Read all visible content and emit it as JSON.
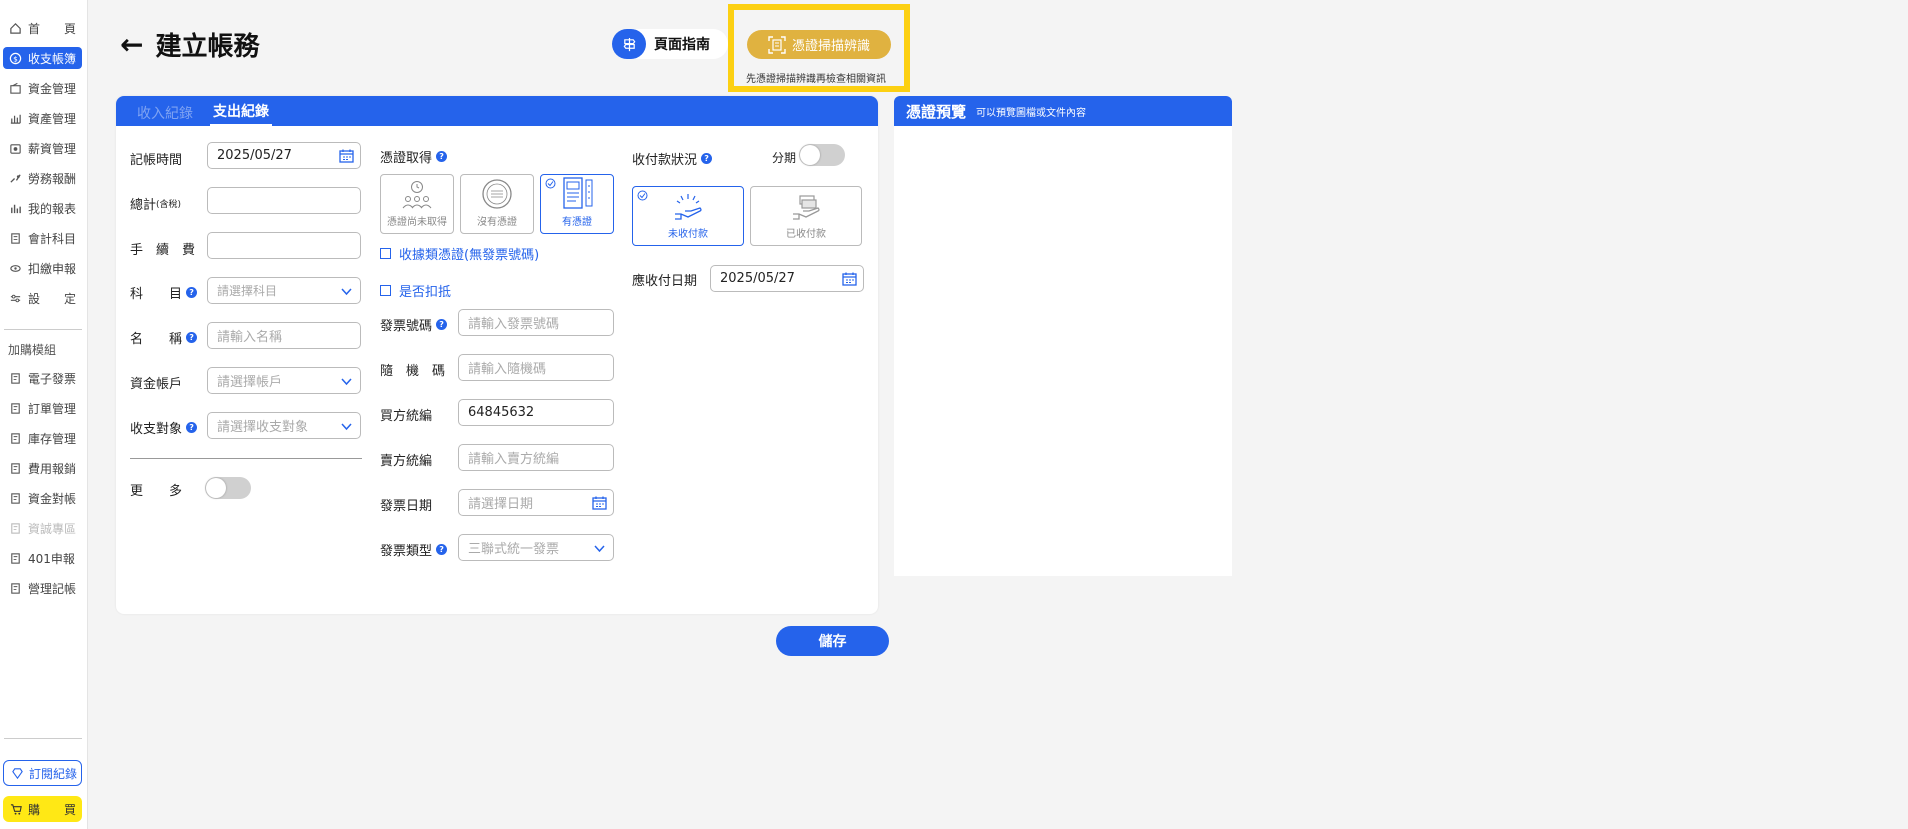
{
  "sidebar": {
    "items": [
      {
        "label": "首　　頁",
        "icon": "home-icon"
      },
      {
        "label": "收支帳簿",
        "icon": "dollar-circle-icon"
      },
      {
        "label": "資金管理",
        "icon": "wallet-icon"
      },
      {
        "label": "資產管理",
        "icon": "asset-chart-icon"
      },
      {
        "label": "薪資管理",
        "icon": "salary-icon"
      },
      {
        "label": "勞務報酬",
        "icon": "service-icon"
      },
      {
        "label": "我的報表",
        "icon": "report-chart-icon"
      },
      {
        "label": "會計科目",
        "icon": "account-book-icon"
      },
      {
        "label": "扣繳申報",
        "icon": "declare-icon"
      },
      {
        "label": "設　　定",
        "icon": "settings-sliders-icon"
      }
    ],
    "addon_section": "加購模組",
    "addon_items": [
      {
        "label": "電子發票",
        "icon": "document-icon"
      },
      {
        "label": "訂單管理",
        "icon": "document-icon"
      },
      {
        "label": "庫存管理",
        "icon": "document-icon"
      },
      {
        "label": "費用報銷",
        "icon": "document-icon"
      },
      {
        "label": "資金對帳",
        "icon": "document-icon"
      },
      {
        "label": "資誠專區",
        "icon": "document-icon"
      },
      {
        "label": "401申報",
        "icon": "document-icon"
      },
      {
        "label": "營理記帳",
        "icon": "document-icon"
      }
    ],
    "subscription": "訂閱紀錄",
    "buy": "購　　買"
  },
  "header": {
    "title": "建立帳務",
    "guide_label": "頁面指南",
    "scan_label": "憑證掃描辨識",
    "scan_hint": "先憑證掃描辨識再檢查相關資訊"
  },
  "tabs": {
    "income": "收入紀錄",
    "expense": "支出紀錄"
  },
  "form": {
    "record_time_label": "記帳時間",
    "record_time_value": "2025/05/27",
    "total_label": "總計",
    "total_suffix": "(含稅)",
    "fee_label": "手　續　費",
    "subject_label": "科　　目",
    "subject_placeholder": "請選擇科目",
    "name_label": "名　　稱",
    "name_placeholder": "請輸入名稱",
    "account_label": "資金帳戶",
    "account_placeholder": "請選擇帳戶",
    "target_label": "收支對象",
    "target_placeholder": "請選擇收支對象",
    "more_label": "更　　多"
  },
  "voucher": {
    "label": "憑證取得",
    "options": [
      "憑證尚未取得",
      "沒有憑證",
      "有憑證"
    ],
    "receipt_type": "收據類憑證(無發票號碼)",
    "deduct": "是否扣抵",
    "invoice_no_label": "發票號碼",
    "invoice_no_placeholder": "請輸入發票號碼",
    "random_label": "隨　機　碼",
    "random_placeholder": "請輸入隨機碼",
    "buyer_label": "買方統編",
    "buyer_value": "64845632",
    "seller_label": "賣方統編",
    "seller_placeholder": "請輸入賣方統編",
    "invoice_date_label": "發票日期",
    "invoice_date_placeholder": "請選擇日期",
    "invoice_type_label": "發票類型",
    "invoice_type_value": "三聯式統一發票"
  },
  "payment": {
    "label": "收付款狀況",
    "installment_label": "分期",
    "options": [
      "未收付款",
      "已收付款"
    ],
    "due_label": "應收付日期",
    "due_value": "2025/05/27"
  },
  "save_label": "儲存",
  "preview": {
    "title": "憑證預覽",
    "subtitle": "可以預覽圖檔或文件內容"
  },
  "colors": {
    "primary": "#2563eb",
    "scan_button": "#e0b240",
    "highlight": "#fcd012",
    "buy": "#ffe815"
  }
}
